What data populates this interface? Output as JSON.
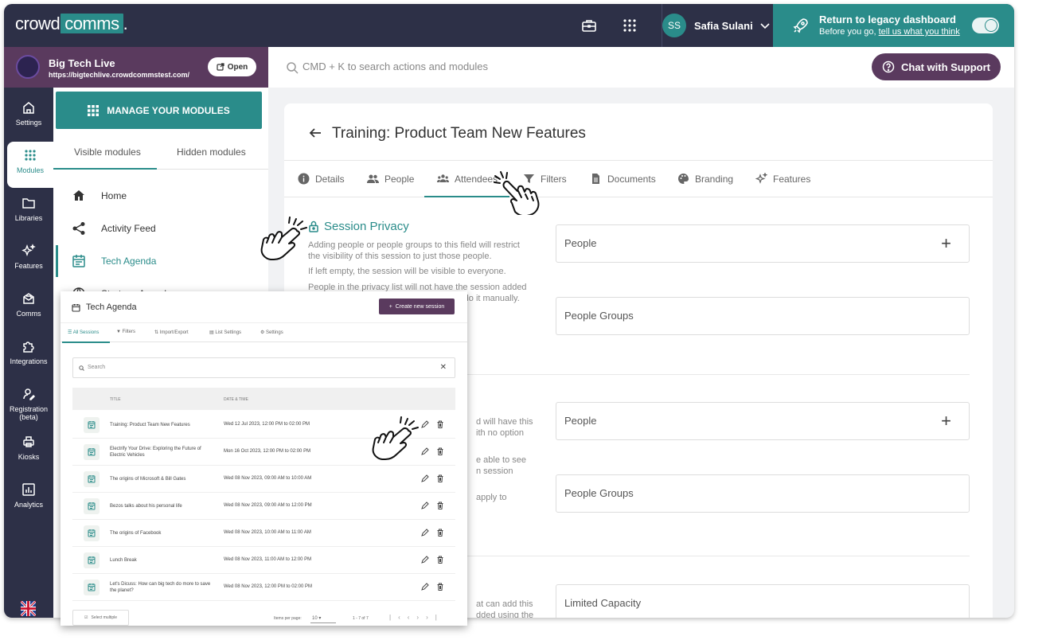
{
  "topbar": {
    "logo_left": "crowd",
    "logo_box": "comms",
    "logo_dot": ".",
    "user_initials": "SS",
    "user_name": "Safia Sulani",
    "legacy_title": "Return to legacy dashboard",
    "legacy_sub": "Before you go,",
    "legacy_link": "tell us what you think"
  },
  "event": {
    "name": "Big Tech Live",
    "url": "https://bigtechlive.crowdcommstest.com/",
    "open_label": "Open"
  },
  "search": {
    "placeholder": "CMD + K to search actions and modules"
  },
  "chat": {
    "label": "Chat with Support"
  },
  "rail": {
    "items": [
      {
        "label": "Settings",
        "icon": "home-icon"
      },
      {
        "label": "Modules",
        "icon": "grid-icon"
      },
      {
        "label": "Libraries",
        "icon": "folder-icon"
      },
      {
        "label": "Features",
        "icon": "sparkle-icon"
      },
      {
        "label": "Comms",
        "icon": "mail-icon"
      },
      {
        "label": "Integrations",
        "icon": "puzzle-icon"
      },
      {
        "label": "Registration",
        "label2": "(beta)",
        "icon": "user-edit-icon"
      },
      {
        "label": "Kiosks",
        "icon": "printer-icon"
      },
      {
        "label": "Analytics",
        "icon": "chart-icon"
      }
    ]
  },
  "modules": {
    "manage_label": "MANAGE YOUR MODULES",
    "tab_visible": "Visible modules",
    "tab_hidden": "Hidden modules",
    "items": [
      {
        "label": "Home"
      },
      {
        "label": "Activity Feed"
      },
      {
        "label": "Tech Agenda"
      },
      {
        "label": "Startups Agenda"
      }
    ]
  },
  "main": {
    "title": "Training: Product Team New Features",
    "tabs": [
      "Details",
      "People",
      "Attendees",
      "Filters",
      "Documents",
      "Branding",
      "Features"
    ],
    "privacy": {
      "title": "Session Privacy",
      "desc1": "Adding people or people groups to this field will restrict the visibility of this session to just those people.",
      "desc2": "If left empty, the session will be visible to everyone.",
      "desc3": "People in the privacy list will not have the session added",
      "desc3b": "to their schedule but they will be able to do it manually."
    },
    "fields": {
      "people": "People",
      "people_groups": "People Groups",
      "limited_capacity": "Limited Capacity"
    },
    "fragments": {
      "f1": "d will have this",
      "f2": "ith no option",
      "f3": "e able to see",
      "f4": "n session",
      "f5": "apply to",
      "f6": "at can add this",
      "f7": "dded using the"
    }
  },
  "overlay": {
    "title": "Tech Agenda",
    "create_label": "Create new session",
    "tabs": [
      "All Sessions",
      "Filters",
      "Import/Export",
      "List Settings",
      "Settings"
    ],
    "search_placeholder": "Search",
    "col_title": "TITLE",
    "col_date": "DATE & TIME",
    "rows": [
      {
        "title": "Training: Product Team New Features",
        "date": "Wed 12 Jul 2023, 12:00 PM to 02:00 PM"
      },
      {
        "title": "Electrify Your Drive: Exploring the Future of Electric Vehicles",
        "date": "Mon 16 Oct 2023, 12:00 PM to 02:00 PM"
      },
      {
        "title": "The origins of Microsoft & Bill Gates",
        "date": "Wed 08 Nov 2023, 09:00 AM to 10:00 AM"
      },
      {
        "title": "Bezos talks about his personal life",
        "date": "Wed 08 Nov 2023, 09:00 AM to 12:00 PM"
      },
      {
        "title": "The origins of Facebook",
        "date": "Wed 08 Nov 2023, 10:00 AM to 11:00 AM"
      },
      {
        "title": "Lunch Break",
        "date": "Wed 08 Nov 2023, 11:00 AM to 12:00 PM"
      },
      {
        "title": "Let's Dicuss: How can big tech do more to save the planet?",
        "date": "Wed 08 Nov 2023, 12:00 PM to 02:00 PM"
      }
    ],
    "select_multiple": "Select multiple",
    "items_per_page_label": "Items per page:",
    "items_per_page": "10",
    "range": "1 - 7 of 7"
  },
  "colors": {
    "navy": "#2d3047",
    "teal": "#2a8c8a",
    "plum": "#5a3a5e"
  }
}
